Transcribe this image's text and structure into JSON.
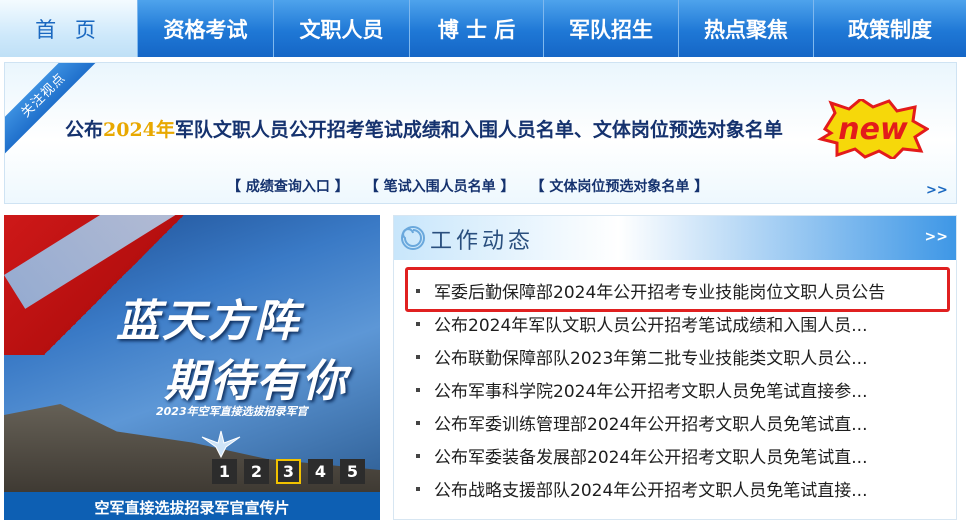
{
  "nav": {
    "items": [
      {
        "label": "首 页",
        "active": true
      },
      {
        "label": "资格考试",
        "active": false
      },
      {
        "label": "文职人员",
        "active": false
      },
      {
        "label": "博 士 后",
        "active": false
      },
      {
        "label": "军队招生",
        "active": false
      },
      {
        "label": "热点聚焦",
        "active": false
      },
      {
        "label": "政策制度",
        "active": false
      }
    ]
  },
  "banner": {
    "ribbon": "关注视点",
    "headline_prefix": "公布",
    "headline_year": "2024年",
    "headline_suffix": "军队文职人员公开招考笔试成绩和入围人员名单、文体岗位预选对象名单",
    "badge": "new",
    "links": [
      "成绩查询入口",
      "笔试入围人员名单",
      "文体岗位预选对象名单"
    ],
    "more": ">>"
  },
  "promo": {
    "title_line1": "蓝天方阵",
    "title_line2": "期待有你",
    "subtitle": "2023年空军直接选拔招录军官",
    "slides": [
      "1",
      "2",
      "3",
      "4",
      "5"
    ],
    "active_slide": 3,
    "caption": "空军直接选拔招录军官宣传片"
  },
  "news": {
    "title": "工作动态",
    "more": ">>",
    "items": [
      "军委后勤保障部2024年公开招考专业技能岗位文职人员公告",
      "公布2024年军队文职人员公开招考笔试成绩和入围人员...",
      "公布联勤保障部队2023年第二批专业技能类文职人员公...",
      "公布军事科学院2024年公开招考文职人员免笔试直接参...",
      "公布军委训练管理部2024年公开招考文职人员免笔试直...",
      "公布军委装备发展部2024年公开招考文职人员免笔试直...",
      "公布战略支援部队2024年公开招考文职人员免笔试直接..."
    ]
  },
  "colors": {
    "nav_blue": "#1f78d6",
    "highlight_red": "#e02020",
    "headline_navy": "#15326e",
    "year_gold": "#e8a800"
  }
}
